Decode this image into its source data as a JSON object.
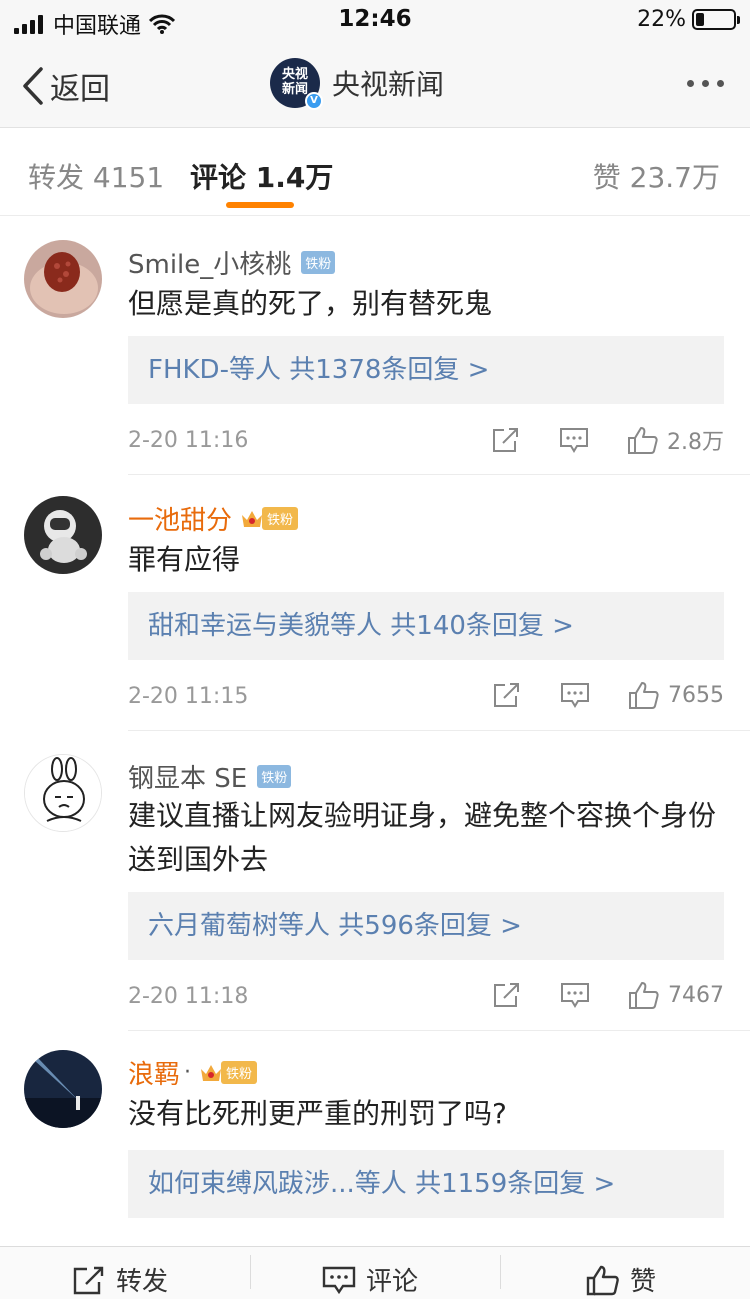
{
  "status_bar": {
    "carrier": "中国联通",
    "time": "12:46",
    "battery_percent": "22%",
    "battery_level": 0.22
  },
  "nav": {
    "back_label": "返回",
    "account_avatar_text": "央视新闻",
    "account_name": "央视新闻",
    "verified_mark": "V"
  },
  "tabs": {
    "repost": {
      "label": "转发",
      "count": "4151"
    },
    "comment": {
      "label": "评论",
      "count": "1.4万"
    },
    "like": {
      "label": "赞",
      "count": "23.7万"
    }
  },
  "comments": [
    {
      "username": "Smile_小核桃",
      "badge": "铁粉",
      "text": "但愿是真的死了，别有替死鬼",
      "replies_people": "FHKD-等人",
      "replies_count": "共1378条回复 >",
      "time": "2-20 11:16",
      "likes": "2.8万"
    },
    {
      "username": "一池甜分",
      "badge": "铁粉",
      "text": "罪有应得",
      "replies_people": "甜和幸运与美貌等人",
      "replies_count": "共140条回复 >",
      "time": "2-20 11:15",
      "likes": "7655"
    },
    {
      "username": "钢显本 SE",
      "badge": "铁粉",
      "text": "建议直播让网友验明证身，避免整个容换个身份送到国外去",
      "replies_people": "六月葡萄树等人",
      "replies_count": "共596条回复 >",
      "time": "2-20 11:18",
      "likes": "7467"
    },
    {
      "username": "浪羁",
      "username_suffix": "·",
      "badge": "铁粉",
      "text": "没有比死刑更严重的刑罚了吗?",
      "replies_people": "如何束缚风跋涉...等人",
      "replies_count": "共1159条回复 >",
      "time": "",
      "likes": ""
    }
  ],
  "bottom_bar": {
    "repost": "转发",
    "comment": "评论",
    "like": "赞"
  }
}
